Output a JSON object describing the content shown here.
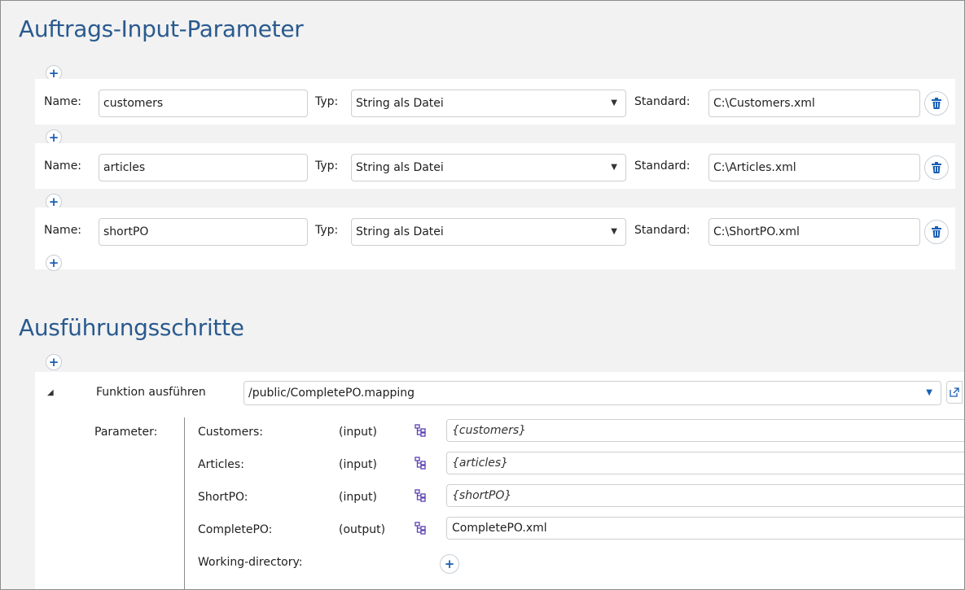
{
  "sections": {
    "input_params_title": "Auftrags-Input-Parameter",
    "exec_steps_title": "Ausführungsschritte"
  },
  "icons": {
    "add": "+",
    "delete": "trash-icon",
    "dropdown": "▼"
  },
  "labels": {
    "name": "Name:",
    "type": "Typ:",
    "default": "Standard:"
  },
  "input_params": [
    {
      "name": "customers",
      "type": "String als Datei",
      "default": "C:\\Customers.xml"
    },
    {
      "name": "articles",
      "type": "String als Datei",
      "default": "C:\\Articles.xml"
    },
    {
      "name": "shortPO",
      "type": "String als Datei",
      "default": "C:\\ShortPO.xml"
    }
  ],
  "step": {
    "toggle": "◢",
    "label": "Funktion ausführen",
    "path": "/public/CompletePO.mapping",
    "params_label": "Parameter:",
    "params": [
      {
        "name": "Customers:",
        "direction": "(input)",
        "value": "{customers}"
      },
      {
        "name": "Articles:",
        "direction": "(input)",
        "value": "{articles}"
      },
      {
        "name": "ShortPO:",
        "direction": "(input)",
        "value": "{shortPO}"
      },
      {
        "name": "CompletePO:",
        "direction": "(output)",
        "value": "CompletePO.xml"
      }
    ],
    "working_dir_label": "Working-directory:"
  },
  "colors": {
    "title": "#2a5a8f",
    "accent": "#1a5fb4",
    "tree_icon": "#5b3fb0"
  }
}
